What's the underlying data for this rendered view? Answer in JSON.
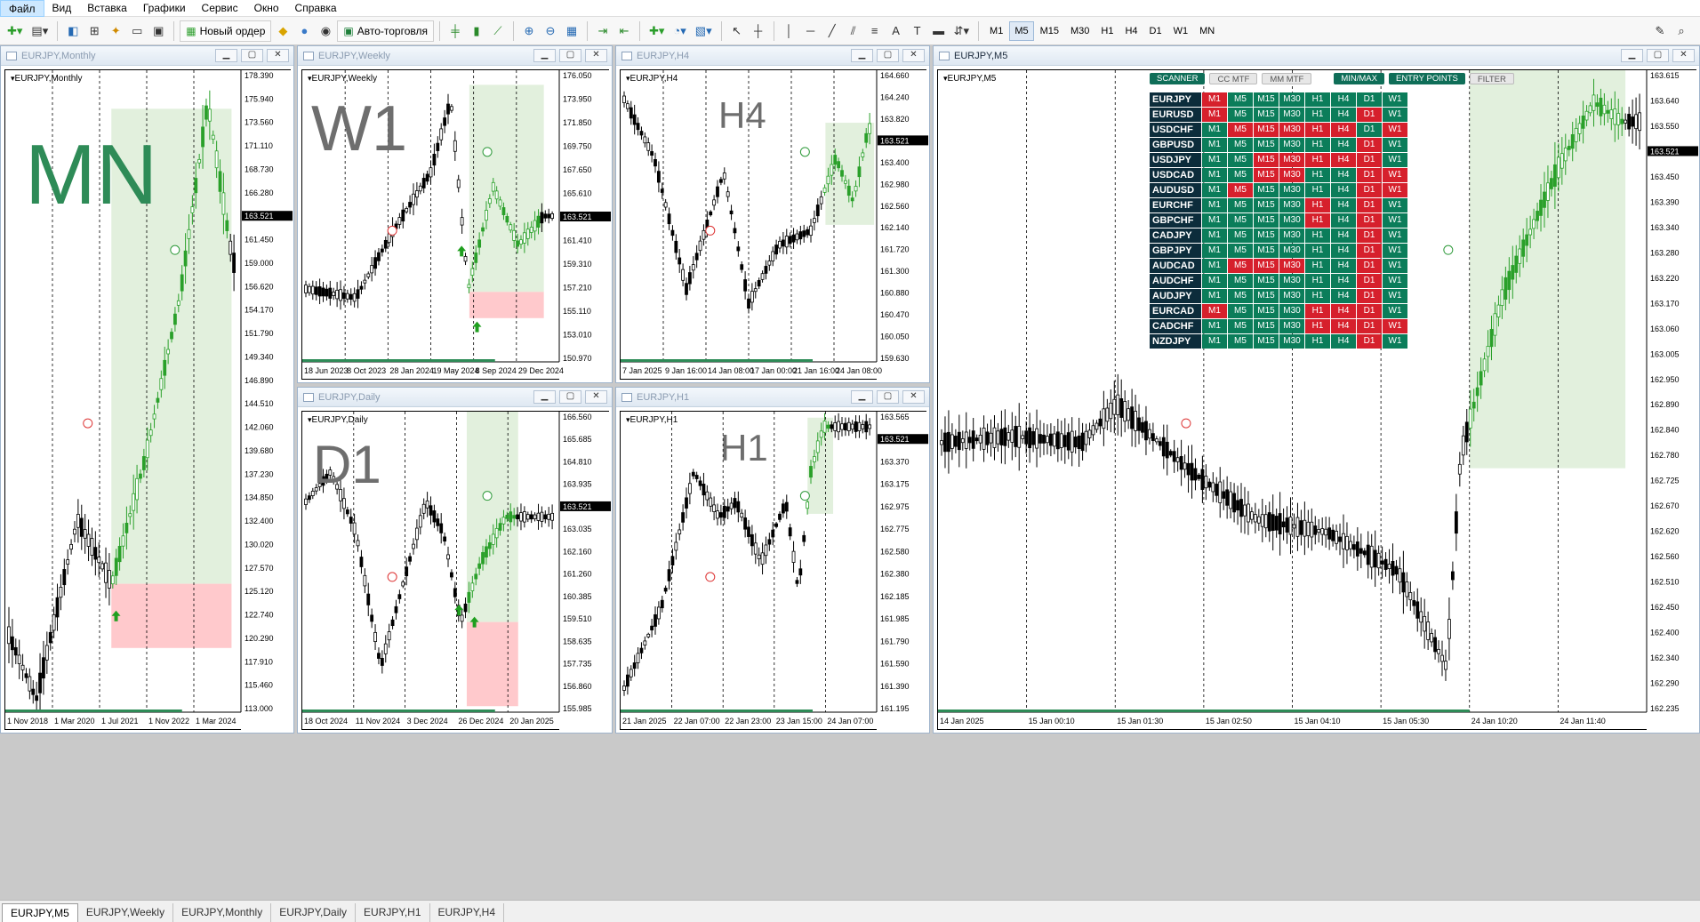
{
  "menu": [
    "Файл",
    "Вид",
    "Вставка",
    "Графики",
    "Сервис",
    "Окно",
    "Справка"
  ],
  "toolbar": {
    "new_order": "Новый ордер",
    "autotrading": "Авто-торговля",
    "timeframes": [
      "M1",
      "M5",
      "M15",
      "M30",
      "H1",
      "H4",
      "D1",
      "W1",
      "MN"
    ],
    "active_timeframe": "M5"
  },
  "windows": [
    {
      "id": "mn",
      "title": "EURJPY,Monthly",
      "symbol": "EURJPY,Monthly",
      "label": "MN",
      "label_color": "#2e8b57",
      "prices": [
        "178.390",
        "175.940",
        "173.560",
        "171.110",
        "168.730",
        "166.280",
        "163.521",
        "161.450",
        "159.000",
        "156.620",
        "154.170",
        "151.790",
        "149.340",
        "146.890",
        "144.510",
        "142.060",
        "139.680",
        "137.230",
        "134.850",
        "132.400",
        "130.020",
        "127.570",
        "125.120",
        "122.740",
        "120.290",
        "117.910",
        "115.460",
        "113.000"
      ],
      "dates": [
        "1 Nov 2018",
        "1 Mar 2020",
        "1 Jul 2021",
        "1 Nov 2022",
        "1 Mar 2024"
      ]
    },
    {
      "id": "w1",
      "title": "EURJPY,Weekly",
      "symbol": "EURJPY,Weekly",
      "label": "W1",
      "label_color": "#6e6e6e",
      "prices": [
        "176.050",
        "173.950",
        "171.850",
        "169.750",
        "167.650",
        "165.610",
        "163.521",
        "161.410",
        "159.310",
        "157.210",
        "155.110",
        "153.010",
        "150.970"
      ],
      "dates": [
        "18 Jun 2023",
        "8 Oct 2023",
        "28 Jan 2024",
        "19 May 2024",
        "8 Sep 2024",
        "29 Dec 2024"
      ]
    },
    {
      "id": "h4",
      "title": "EURJPY,H4",
      "symbol": "EURJPY,H4",
      "label": "H4",
      "label_color": "#6e6e6e",
      "prices": [
        "164.660",
        "164.240",
        "163.820",
        "163.521",
        "163.400",
        "162.980",
        "162.560",
        "162.140",
        "161.720",
        "161.300",
        "160.880",
        "160.470",
        "160.050",
        "159.630"
      ],
      "dates": [
        "7 Jan 2025",
        "9 Jan 16:00",
        "14 Jan 08:00",
        "17 Jan 00:00",
        "21 Jan 16:00",
        "24 Jan 08:00"
      ]
    },
    {
      "id": "d1",
      "title": "EURJPY,Daily",
      "symbol": "EURJPY,Daily",
      "label": "D1",
      "label_color": "#6e6e6e",
      "prices": [
        "166.560",
        "165.685",
        "164.810",
        "163.935",
        "163.521",
        "163.035",
        "162.160",
        "161.260",
        "160.385",
        "159.510",
        "158.635",
        "157.735",
        "156.860",
        "155.985"
      ],
      "dates": [
        "18 Oct 2024",
        "11 Nov 2024",
        "3 Dec 2024",
        "26 Dec 2024",
        "20 Jan 2025"
      ]
    },
    {
      "id": "h1",
      "title": "EURJPY,H1",
      "symbol": "EURJPY,H1",
      "label": "H1",
      "label_color": "#6e6e6e",
      "prices": [
        "163.565",
        "163.521",
        "163.370",
        "163.175",
        "162.975",
        "162.775",
        "162.580",
        "162.380",
        "162.185",
        "161.985",
        "161.790",
        "161.590",
        "161.390",
        "161.195"
      ],
      "dates": [
        "21 Jan 2025",
        "22 Jan 07:00",
        "22 Jan 23:00",
        "23 Jan 15:00",
        "24 Jan 07:00"
      ]
    },
    {
      "id": "m5",
      "title": "EURJPY,M5",
      "symbol": "EURJPY,M5",
      "label": "",
      "label_color": "#6e6e6e",
      "prices": [
        "163.615",
        "163.640",
        "163.550",
        "163.521",
        "163.450",
        "163.390",
        "163.340",
        "163.280",
        "163.220",
        "163.170",
        "163.060",
        "163.005",
        "162.950",
        "162.890",
        "162.840",
        "162.780",
        "162.725",
        "162.670",
        "162.620",
        "162.560",
        "162.510",
        "162.450",
        "162.400",
        "162.340",
        "162.290",
        "162.235"
      ],
      "dates": [
        "14 Jan 2025",
        "15 Jan 00:10",
        "15 Jan 01:30",
        "15 Jan 02:50",
        "15 Jan 04:10",
        "15 Jan 05:30",
        "24 Jan 10:20",
        "24 Jan 11:40"
      ]
    }
  ],
  "scanner": {
    "buttons": [
      "SCANNER",
      "CC MTF",
      "MM MTF",
      "MIN/MAX",
      "ENTRY POINTS",
      "FILTER"
    ],
    "columns": [
      "M1",
      "M5",
      "M15",
      "M30",
      "H1",
      "H4",
      "D1",
      "W1"
    ],
    "rows": [
      {
        "sym": "EURJPY",
        "cells": [
          "r",
          "g",
          "g",
          "g",
          "g",
          "g",
          "g",
          "g"
        ]
      },
      {
        "sym": "EURUSD",
        "cells": [
          "r",
          "g",
          "g",
          "g",
          "g",
          "g",
          "r",
          "g"
        ]
      },
      {
        "sym": "USDCHF",
        "cells": [
          "g",
          "r",
          "r",
          "r",
          "r",
          "r",
          "g",
          "r"
        ]
      },
      {
        "sym": "GBPUSD",
        "cells": [
          "g",
          "g",
          "g",
          "g",
          "g",
          "g",
          "r",
          "g"
        ]
      },
      {
        "sym": "USDJPY",
        "cells": [
          "g",
          "g",
          "r",
          "r",
          "r",
          "r",
          "r",
          "g"
        ]
      },
      {
        "sym": "USDCAD",
        "cells": [
          "g",
          "g",
          "r",
          "r",
          "g",
          "g",
          "r",
          "r"
        ]
      },
      {
        "sym": "AUDUSD",
        "cells": [
          "g",
          "r",
          "g",
          "g",
          "g",
          "g",
          "r",
          "r"
        ]
      },
      {
        "sym": "EURCHF",
        "cells": [
          "g",
          "g",
          "g",
          "g",
          "r",
          "g",
          "r",
          "g"
        ]
      },
      {
        "sym": "GBPCHF",
        "cells": [
          "g",
          "g",
          "g",
          "g",
          "r",
          "g",
          "r",
          "g"
        ]
      },
      {
        "sym": "CADJPY",
        "cells": [
          "g",
          "g",
          "g",
          "g",
          "g",
          "g",
          "r",
          "g"
        ]
      },
      {
        "sym": "GBPJPY",
        "cells": [
          "g",
          "g",
          "g",
          "g",
          "g",
          "g",
          "r",
          "g"
        ]
      },
      {
        "sym": "AUDCAD",
        "cells": [
          "g",
          "r",
          "r",
          "r",
          "g",
          "g",
          "r",
          "g"
        ]
      },
      {
        "sym": "AUDCHF",
        "cells": [
          "g",
          "g",
          "g",
          "g",
          "g",
          "g",
          "r",
          "g"
        ]
      },
      {
        "sym": "AUDJPY",
        "cells": [
          "g",
          "g",
          "g",
          "g",
          "g",
          "g",
          "r",
          "g"
        ]
      },
      {
        "sym": "EURCAD",
        "cells": [
          "r",
          "g",
          "g",
          "g",
          "r",
          "r",
          "r",
          "g"
        ]
      },
      {
        "sym": "CADCHF",
        "cells": [
          "g",
          "g",
          "g",
          "g",
          "r",
          "r",
          "r",
          "r"
        ]
      },
      {
        "sym": "NZDJPY",
        "cells": [
          "g",
          "g",
          "g",
          "g",
          "g",
          "g",
          "r",
          "g"
        ]
      }
    ]
  },
  "tabs": [
    "EURJPY,M5",
    "EURJPY,Weekly",
    "EURJPY,Monthly",
    "EURJPY,Daily",
    "EURJPY,H1",
    "EURJPY,H4"
  ],
  "active_tab": "EURJPY,M5",
  "colors": {
    "bull_zone": "#e2f0dd",
    "bear_zone": "#ffc9cc",
    "up_arrow": "#1f9f1f",
    "marker_green": "#2e9a3a",
    "marker_red": "#e0806a",
    "scanner_green": "#0b7d5a",
    "scanner_red": "#d6202c"
  }
}
